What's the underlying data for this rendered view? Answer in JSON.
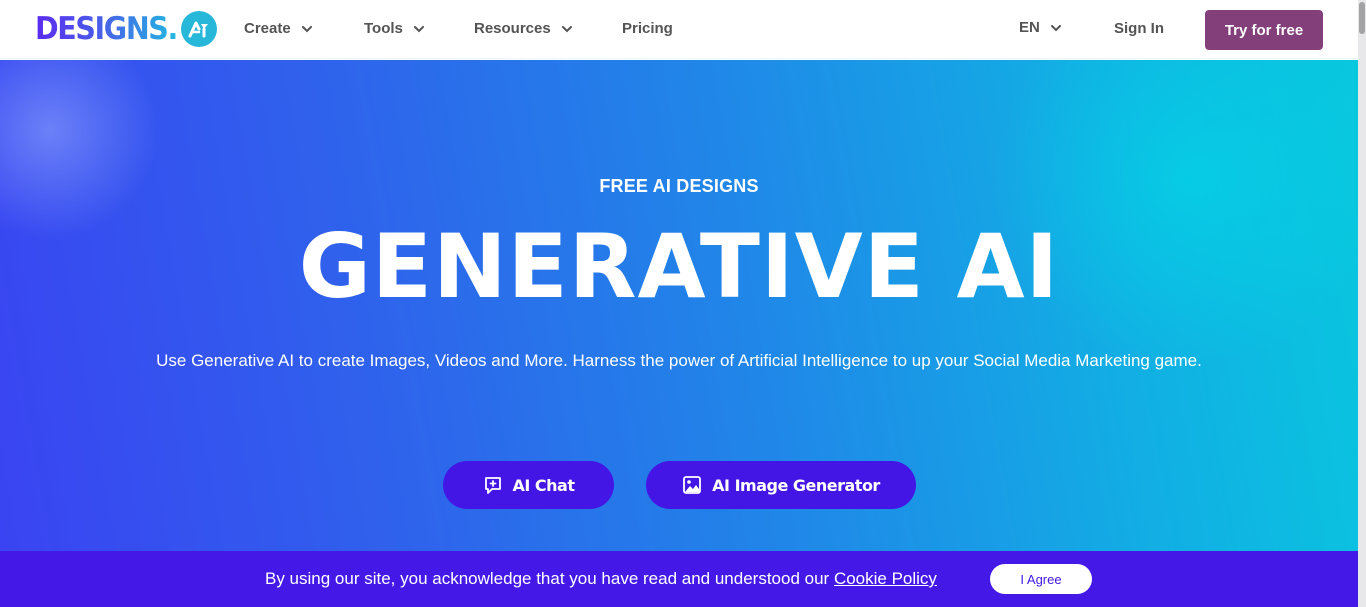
{
  "header": {
    "logo_text": "DESIGNS.",
    "logo_badge": "AI",
    "nav": [
      {
        "label": "Create",
        "has_dropdown": true
      },
      {
        "label": "Tools",
        "has_dropdown": true
      },
      {
        "label": "Resources",
        "has_dropdown": true
      },
      {
        "label": "Pricing",
        "has_dropdown": false
      }
    ],
    "language": "EN",
    "sign_in": "Sign In",
    "cta": "Try for free"
  },
  "hero": {
    "eyebrow": "FREE AI DESIGNS",
    "title": "GENERATIVE AI",
    "subtitle": "Use Generative AI to create Images, Videos and More. Harness the power of Artificial Intelligence to up your Social Media Marketing game.",
    "buttons": [
      {
        "label": "AI Chat",
        "icon": "chat-plus-icon"
      },
      {
        "label": "AI Image Generator",
        "icon": "image-icon"
      }
    ]
  },
  "cookie": {
    "text": "By using our site, you acknowledge that you have read and understood our ",
    "link": "Cookie Policy",
    "agree": "I Agree"
  },
  "colors": {
    "brand_purple": "#823f7a",
    "cta_blue": "#4316e6",
    "cookie_bg": "#4419e8",
    "logo_badge": "#27b7d8"
  }
}
